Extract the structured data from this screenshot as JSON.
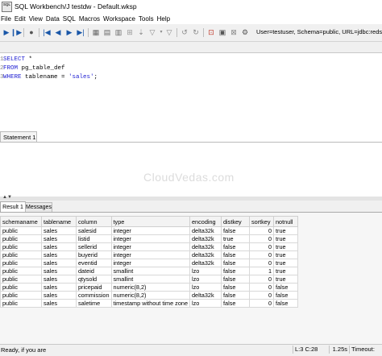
{
  "window": {
    "title": "SQL Workbench/J testdw - Default.wksp",
    "app_icon_text": "SQL"
  },
  "menu": [
    "File",
    "Edit",
    "View",
    "Data",
    "SQL",
    "Macros",
    "Workspace",
    "Tools",
    "Help"
  ],
  "toolbar": {
    "connection_info": "User=testuser, Schema=public, URL=jdbc:redshift:"
  },
  "editor": {
    "lines": [
      {
        "num": "1",
        "kw": "SELECT",
        "rest": " *"
      },
      {
        "num": "2",
        "kw": "FROM",
        "rest": " pg_table_def"
      },
      {
        "num": "3",
        "kw": "WHERE",
        "rest": " tablename = ",
        "str": "'sales'",
        "end": ";"
      }
    ],
    "statement_tab": "Statement 1",
    "watermark": "CloudVedas.com"
  },
  "results": {
    "tabs": [
      "Result 1",
      "Messages"
    ],
    "columns": [
      "schemaname",
      "tablename",
      "column",
      "type",
      "encoding",
      "distkey",
      "sortkey",
      "notnull"
    ],
    "rows": [
      [
        "public",
        "sales",
        "salesid",
        "integer",
        "delta32k",
        "false",
        "0",
        "true"
      ],
      [
        "public",
        "sales",
        "listid",
        "integer",
        "delta32k",
        "true",
        "0",
        "true"
      ],
      [
        "public",
        "sales",
        "sellerid",
        "integer",
        "delta32k",
        "false",
        "0",
        "true"
      ],
      [
        "public",
        "sales",
        "buyerid",
        "integer",
        "delta32k",
        "false",
        "0",
        "true"
      ],
      [
        "public",
        "sales",
        "eventid",
        "integer",
        "delta32k",
        "false",
        "0",
        "true"
      ],
      [
        "public",
        "sales",
        "dateid",
        "smallint",
        "lzo",
        "false",
        "1",
        "true"
      ],
      [
        "public",
        "sales",
        "qtysold",
        "smallint",
        "lzo",
        "false",
        "0",
        "true"
      ],
      [
        "public",
        "sales",
        "pricepaid",
        "numeric(8,2)",
        "lzo",
        "false",
        "0",
        "false"
      ],
      [
        "public",
        "sales",
        "commission",
        "numeric(8,2)",
        "delta32k",
        "false",
        "0",
        "false"
      ],
      [
        "public",
        "sales",
        "saletime",
        "timestamp without time zone",
        "lzo",
        "false",
        "0",
        "false"
      ]
    ]
  },
  "status": {
    "message": "Ready, if you are",
    "cursor": "L:3 C:28",
    "exec_time": "1.25s",
    "timeout": "Timeout:"
  },
  "colors": {
    "keyword": "#1b1bd1",
    "toolbar_icon": "#1a57a8"
  }
}
